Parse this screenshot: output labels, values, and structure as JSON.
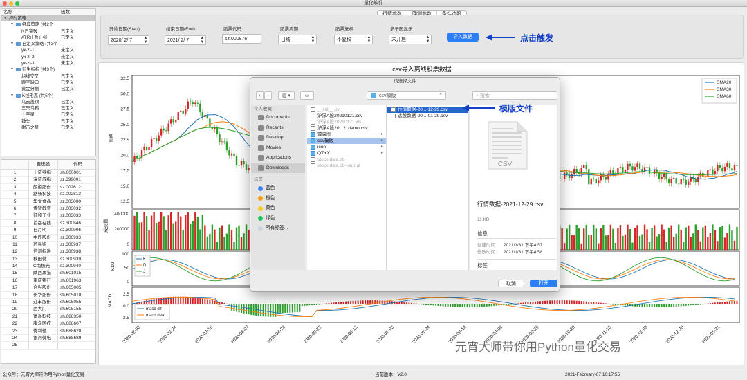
{
  "window": {
    "title": "量化软件"
  },
  "strategy_tree": {
    "columns": [
      "名称",
      "函数"
    ],
    "rows": [
      {
        "indent": 0,
        "name": "择时策略",
        "status": "",
        "selected": true,
        "toggle": "▼"
      },
      {
        "indent": 1,
        "name": "经典策略 (共2个",
        "status": "",
        "toggle": "▼",
        "folder": true
      },
      {
        "indent": 2,
        "name": "N日突破",
        "status": "已定义"
      },
      {
        "indent": 2,
        "name": "ATR止盈止损",
        "status": "已定义"
      },
      {
        "indent": 1,
        "name": "自定义策略 (共3个",
        "status": "",
        "toggle": "▼",
        "folder": true
      },
      {
        "indent": 2,
        "name": "yx-zl-1",
        "status": "未定义"
      },
      {
        "indent": 2,
        "name": "yx-zl-2",
        "status": "未定义"
      },
      {
        "indent": 2,
        "name": "yx-zl-3",
        "status": "未定义"
      },
      {
        "indent": 1,
        "name": "衍生指标 (共3个)",
        "status": "",
        "toggle": "▼",
        "folder": true
      },
      {
        "indent": 2,
        "name": "均线交叉",
        "status": "已定义"
      },
      {
        "indent": 2,
        "name": "跳空缺口",
        "status": "已定义"
      },
      {
        "indent": 2,
        "name": "黄金分割",
        "status": "已定义"
      },
      {
        "indent": 1,
        "name": "K线形态 (共5个)",
        "status": "",
        "toggle": "▼",
        "folder": true
      },
      {
        "indent": 2,
        "name": "乌云盖顶",
        "status": "已定义"
      },
      {
        "indent": 2,
        "name": "三只乌鸦",
        "status": "已定义"
      },
      {
        "indent": 2,
        "name": "十字星",
        "status": "已定义"
      },
      {
        "indent": 2,
        "name": "锤头",
        "status": "已定义"
      },
      {
        "indent": 2,
        "name": "射击之星",
        "status": "已定义"
      }
    ]
  },
  "stock_list": {
    "columns": [
      "",
      "自选股",
      "代码"
    ],
    "rows": [
      [
        "1",
        "上证综指",
        "sh.000001"
      ],
      [
        "2",
        "深证成指",
        "sz.399001"
      ],
      [
        "3",
        "朗姿股份",
        "sz.002612"
      ],
      [
        "4",
        "路畅科技",
        "sz.002813"
      ],
      [
        "5",
        "华文食品",
        "sz.003000"
      ],
      [
        "6",
        "传智教育",
        "sz.003032"
      ],
      [
        "7",
        "征和工业",
        "sz.003033"
      ],
      [
        "8",
        "首都在线",
        "sz.300846"
      ],
      [
        "9",
        "日月明",
        "sz.300906"
      ],
      [
        "10",
        "中辰股份",
        "sz.300933"
      ],
      [
        "11",
        "药易购",
        "sz.300937"
      ],
      [
        "12",
        "信测标准",
        "sz.300938"
      ],
      [
        "13",
        "秋田微",
        "sz.300939"
      ],
      [
        "14",
        "C南极光",
        "sz.300940"
      ],
      [
        "15",
        "陕西黑猫",
        "sh.601015"
      ],
      [
        "16",
        "重庆银行",
        "sh.601963"
      ],
      [
        "17",
        "合兴股份",
        "sh.605005"
      ],
      [
        "18",
        "长华股份",
        "sh.605018"
      ],
      [
        "19",
        "迎丰股份",
        "sh.605055"
      ],
      [
        "20",
        "西大门",
        "sh.605155"
      ],
      [
        "21",
        "富淼科技",
        "sh.688350"
      ],
      [
        "22",
        "康众医疗",
        "sh.688607"
      ],
      [
        "23",
        "优利德",
        "sh.688628"
      ],
      [
        "24",
        "银河微电",
        "sh.688689"
      ],
      [
        "25",
        "",
        ""
      ]
    ]
  },
  "tabs": [
    "行情参数",
    "回测参数",
    "条件选股"
  ],
  "params": {
    "start_label": "开始日期(Start)",
    "start_value": "2020/ 2/ 7",
    "end_label": "结束日期(End)",
    "end_value": "2021/ 2/ 7",
    "code_label": "股票代码",
    "code_value": "sz.000876",
    "period_label": "股票周期",
    "period_value": "日线",
    "adjust_label": "股票复权",
    "adjust_value": "不复权",
    "subplot_label": "多子图显示",
    "subplot_value": "未开启",
    "import_button": "导入数据"
  },
  "annotations": {
    "click": "点击触发",
    "template": "模版文件"
  },
  "chart": {
    "title": "csv导入离线股票数据",
    "legend": [
      "SMA20",
      "SMA30",
      "SMA60"
    ],
    "legend_colors": [
      "#1f77b4",
      "#ff7f0e",
      "#2ca02c"
    ],
    "price_ylabel": "价格",
    "price_ticks": [
      "32.5",
      "30.0",
      "27.5",
      "25.0",
      "22.5",
      "20.0",
      "17.5",
      "15.0",
      "12.5"
    ],
    "volume_ylabel": "成交量",
    "volume_ticks": [
      "400000",
      "200000",
      "0"
    ],
    "kdj_ylabel": "KDJ",
    "kdj_ticks": [
      "100",
      "50",
      "0"
    ],
    "kdj_legend": [
      "K",
      "D",
      "J"
    ],
    "macd_ylabel": "MACD",
    "macd_ticks": [
      "2.5",
      "0.0",
      "-2.5"
    ],
    "macd_legend": [
      "macd dif",
      "macd dea"
    ],
    "x_ticks": [
      "2020-02-03",
      "2020-02-24",
      "2020-03-16",
      "2020-04-07",
      "2020-04-28",
      "2020-05-22",
      "2020-06-12",
      "2020-07-03",
      "2020-07-24",
      "2020-08-14",
      "2020-09-08",
      "2020-09-29",
      "2020-10-20",
      "2020-11-18",
      "2020-12-09",
      "2020-12-30",
      "2021-01-21"
    ],
    "watermark": "元宵大师带你用Python量化交易"
  },
  "chart_data": {
    "type": "candlestick",
    "title": "csv导入离线股票数据",
    "ylabel": "价格",
    "ylim": [
      11.5,
      33
    ],
    "series": [
      {
        "name": "SMA20"
      },
      {
        "name": "SMA30"
      },
      {
        "name": "SMA60"
      }
    ],
    "approx_close": [
      {
        "x": "2020-02-03",
        "y": 19
      },
      {
        "x": "2020-02-24",
        "y": 29
      },
      {
        "x": "2020-03-16",
        "y": 19
      },
      {
        "x": "2020-04-07",
        "y": 15.5
      },
      {
        "x": "2020-09-08",
        "y": 20
      },
      {
        "x": "2020-12-30",
        "y": 16
      },
      {
        "x": "2021-01-21",
        "y": 17
      }
    ]
  },
  "dialog": {
    "title": "请选择文件",
    "folder": "csv模版",
    "search_placeholder": "搜索",
    "favorites_header": "个人收藏",
    "favorites": [
      "Documents",
      "Recents",
      "Desktop",
      "Movies",
      "Applications",
      "Downloads"
    ],
    "tags_header": "标签",
    "tags": [
      {
        "name": "蓝色",
        "color": "#3b82f6"
      },
      {
        "name": "橙色",
        "color": "#f59e0b"
      },
      {
        "name": "黄色",
        "color": "#facc15"
      },
      {
        "name": "绿色",
        "color": "#22c55e"
      },
      {
        "name": "所有标签...",
        "color": "#cbd5e1"
      }
    ],
    "column1": [
      {
        "name": "__init__.py",
        "dim": true
      },
      {
        "name": "沪深A股20210121.csv"
      },
      {
        "name": "沪深A股20210121.xls",
        "dim": true
      },
      {
        "name": "沪深A股20...21demo.csv"
      },
      {
        "name": "效果图",
        "folder": true
      },
      {
        "name": "csv模版",
        "folder": true,
        "sel": true
      },
      {
        "name": "icon",
        "folder": true
      },
      {
        "name": "QTYX",
        "folder": true
      },
      {
        "name": "stock-data.db",
        "dim": true
      },
      {
        "name": "stock-data.db-journal",
        "dim": true
      }
    ],
    "column2": [
      {
        "name": "行情数据-20...-12-29.csv",
        "selfocus": true
      },
      {
        "name": "选股数据-20...-01-29.csv"
      }
    ],
    "preview": {
      "icon_text": "CSV",
      "filename": "行情数据-2021-12-29.csv",
      "size": "11 KB",
      "info_header": "信息",
      "created_label": "创建时间",
      "created_value": "2021/1/31 下午4:57",
      "modified_label": "修改时间",
      "modified_value": "2021/1/31 下午4:58",
      "tags_header": "标签"
    },
    "cancel": "取消",
    "open": "打开"
  },
  "status": {
    "left": "公众号：元宵大师带你用Python量化交易",
    "mid": "当前版本：V2.0",
    "right": "2021-February-07 10:17:55"
  }
}
